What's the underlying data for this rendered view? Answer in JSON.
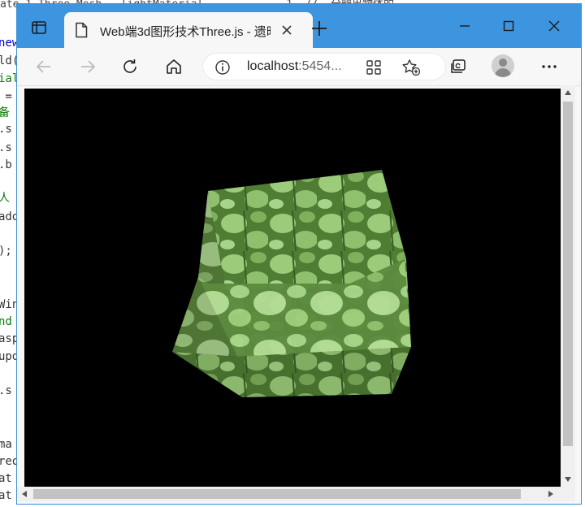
{
  "background_code": {
    "top_text": "ate 1 Three.Mesh...lightMaterial...          1  //  分辨出物体的...",
    "lines": [
      {
        "text": "new",
        "color": "blue"
      },
      {
        "text": "ld(",
        "color": "normal"
      },
      {
        "text": "ial",
        "color": "green"
      },
      {
        "text": " =",
        "color": "normal"
      },
      {
        "text": "备",
        "color": "green"
      },
      {
        "text": ".s",
        "color": "normal"
      },
      {
        "text": ".s",
        "color": "normal"
      },
      {
        "text": ".b",
        "color": "normal"
      },
      {
        "text": "人",
        "color": "green"
      },
      {
        "text": "add",
        "color": "normal"
      },
      {
        "text": ");",
        "color": "normal"
      },
      {
        "text": "Win",
        "color": "normal"
      },
      {
        "text": "nd",
        "color": "green"
      },
      {
        "text": "asp",
        "color": "normal"
      },
      {
        "text": "upd",
        "color": "normal"
      },
      {
        "text": ".s",
        "color": "normal"
      },
      {
        "text": "ma",
        "color": "normal"
      },
      {
        "text": "req",
        "color": "normal"
      },
      {
        "text": "at",
        "color": "normal"
      },
      {
        "text": "at",
        "color": "normal"
      }
    ]
  },
  "browser": {
    "tab_title": "Web端3d图形技术Three.js - 遗昕",
    "address": {
      "host": "localhost",
      "port_suffix": ":5454..."
    }
  },
  "colors": {
    "titlebar": "#3d95e0",
    "canvas_background": "#000000",
    "leaf_green": "#7fbf5a"
  },
  "icons": {
    "tab_actions": "tab-actions-icon",
    "page": "page-icon",
    "close": "close-icon",
    "new_tab": "plus-icon",
    "minimize": "minimize-icon",
    "maximize": "maximize-icon",
    "window_close": "window-close-icon",
    "back": "back-arrow-icon",
    "forward": "forward-arrow-icon",
    "refresh": "refresh-icon",
    "home": "home-icon",
    "info": "info-icon",
    "apps": "apps-grid-icon",
    "favorite": "add-favorite-icon",
    "collections": "collections-icon",
    "profile": "profile-avatar-icon",
    "menu": "more-menu-icon"
  }
}
